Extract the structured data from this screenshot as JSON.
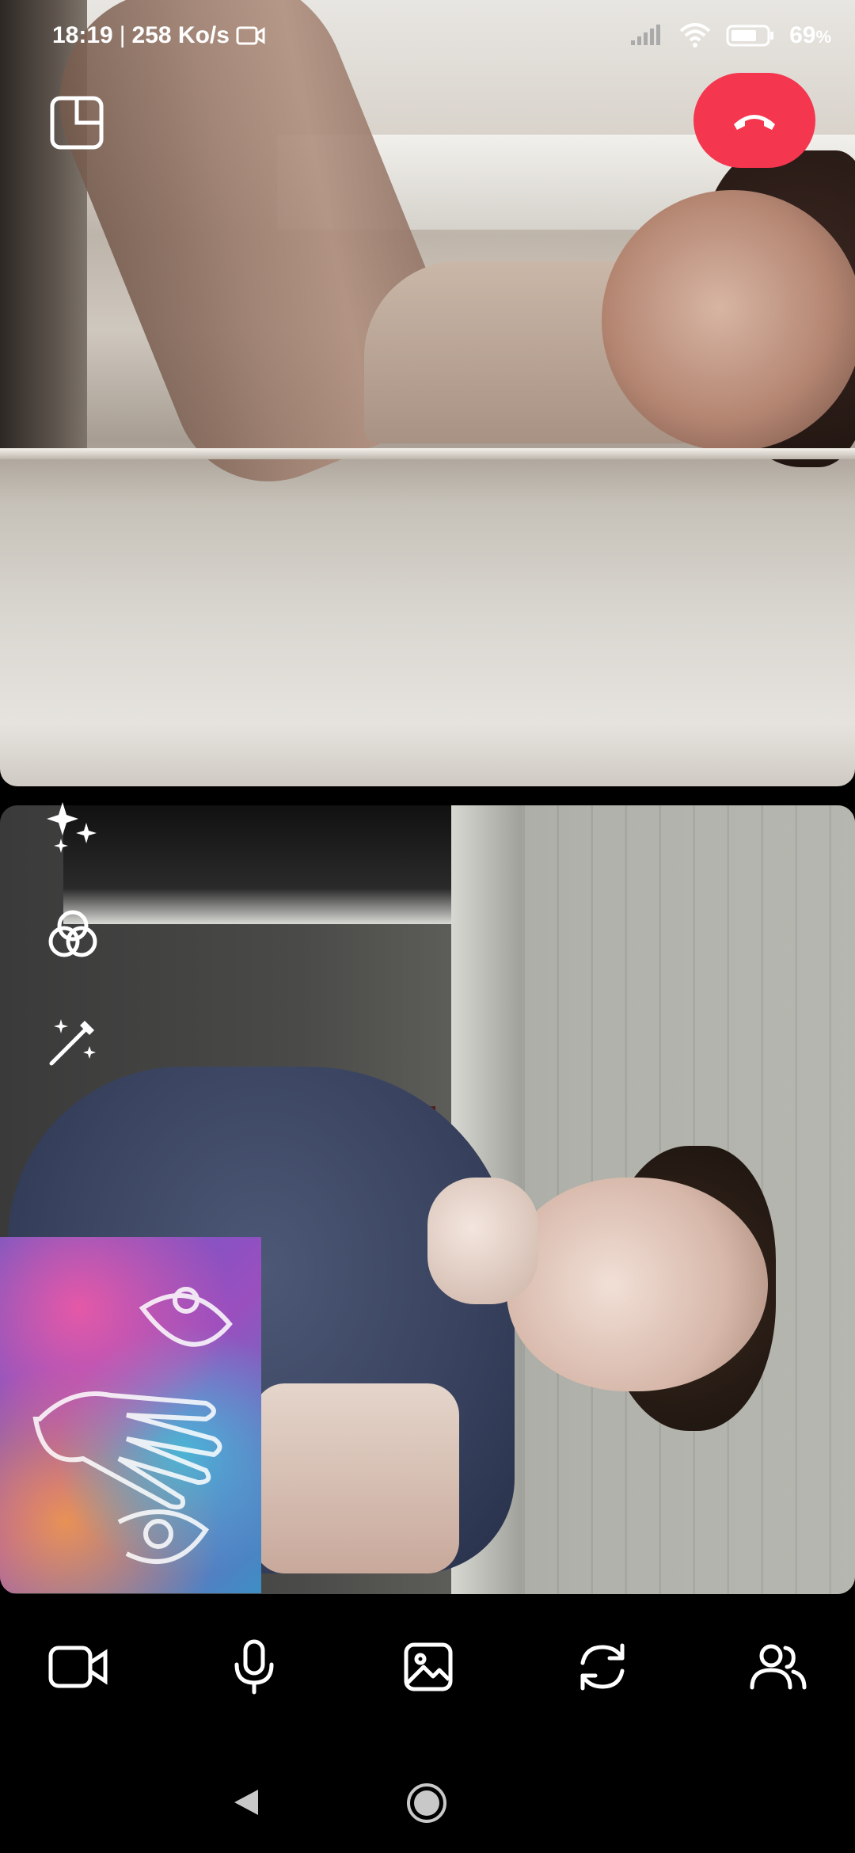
{
  "status_bar": {
    "time": "18:19",
    "separator": "|",
    "speed": "258 Ko/s",
    "battery_level": "69",
    "battery_unit": "%",
    "icons": [
      "video-record-icon",
      "signal-icon",
      "wifi-icon",
      "battery-icon"
    ]
  },
  "call": {
    "layout_button": "layout-icon",
    "hangup_button": "phone-hangup-icon",
    "hangup_color": "#f5364f"
  },
  "effects": [
    "sparkle-effects-icon",
    "filters-icon",
    "magic-wand-icon"
  ],
  "toolbar": [
    "video-camera-icon",
    "microphone-icon",
    "image-icon",
    "switch-camera-icon",
    "participants-icon"
  ],
  "nav": [
    "back-triangle-icon",
    "home-circle-icon"
  ]
}
